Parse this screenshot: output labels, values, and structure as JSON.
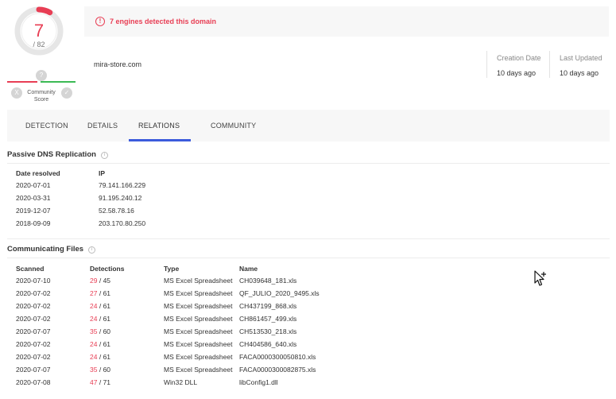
{
  "score": {
    "detections": "7",
    "total": "/ 82",
    "community_score_value": "?",
    "community_label_line1": "Community",
    "community_label_line2": "Score",
    "community_left_icon": "X",
    "community_right_icon": "✓",
    "gauge_fraction": 0.085,
    "colors": {
      "malicious": "#e83e54",
      "harmless": "#3cba54",
      "neutral": "#d5d5d5"
    }
  },
  "header": {
    "alert_text": "7 engines detected this domain",
    "domain": "mira-store.com",
    "creation_date_label": "Creation Date",
    "creation_date_value": "10 days ago",
    "last_updated_label": "Last Updated",
    "last_updated_value": "10 days ago"
  },
  "tabs": [
    {
      "label": "DETECTION",
      "active": false
    },
    {
      "label": "DETAILS",
      "active": false
    },
    {
      "label": "RELATIONS",
      "active": true
    },
    {
      "label": "COMMUNITY",
      "active": false
    }
  ],
  "passive_dns": {
    "title": "Passive DNS Replication",
    "columns": [
      "Date resolved",
      "IP"
    ],
    "rows": [
      [
        "2020-07-01",
        "79.141.166.229"
      ],
      [
        "2020-03-31",
        "91.195.240.12"
      ],
      [
        "2019-12-07",
        "52.58.78.16"
      ],
      [
        "2018-09-09",
        "203.170.80.250"
      ]
    ]
  },
  "communicating_files": {
    "title": "Communicating Files",
    "columns": [
      "Scanned",
      "Detections",
      "Type",
      "Name"
    ],
    "rows": [
      {
        "scanned": "2020-07-10",
        "det": "29",
        "total": "/ 45",
        "type": "MS Excel Spreadsheet",
        "name": "CH039648_181.xls"
      },
      {
        "scanned": "2020-07-02",
        "det": "27",
        "total": "/ 61",
        "type": "MS Excel Spreadsheet",
        "name": "QF_JULIO_2020_9495.xls"
      },
      {
        "scanned": "2020-07-02",
        "det": "24",
        "total": "/ 61",
        "type": "MS Excel Spreadsheet",
        "name": "CH437199_868.xls"
      },
      {
        "scanned": "2020-07-02",
        "det": "24",
        "total": "/ 61",
        "type": "MS Excel Spreadsheet",
        "name": "CH861457_499.xls"
      },
      {
        "scanned": "2020-07-07",
        "det": "35",
        "total": "/ 60",
        "type": "MS Excel Spreadsheet",
        "name": "CH513530_218.xls"
      },
      {
        "scanned": "2020-07-02",
        "det": "24",
        "total": "/ 61",
        "type": "MS Excel Spreadsheet",
        "name": "CH404586_640.xls"
      },
      {
        "scanned": "2020-07-02",
        "det": "24",
        "total": "/ 61",
        "type": "MS Excel Spreadsheet",
        "name": "FACA0000300050810.xls"
      },
      {
        "scanned": "2020-07-07",
        "det": "35",
        "total": "/ 60",
        "type": "MS Excel Spreadsheet",
        "name": "FACA0000300082875.xls"
      },
      {
        "scanned": "2020-07-08",
        "det": "47",
        "total": "/ 71",
        "type": "Win32 DLL",
        "name": "libConfig1.dll"
      }
    ]
  },
  "icons": {
    "alert": "alert-circle-icon",
    "info": "info-circle-icon",
    "cursor": "mouse-pointer-icon"
  }
}
